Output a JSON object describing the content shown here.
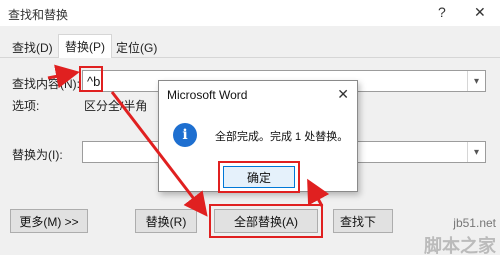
{
  "window": {
    "title": "查找和替换",
    "help_glyph": "?",
    "close_glyph": "✕"
  },
  "tabs": [
    {
      "label": "查找(D)",
      "active": false
    },
    {
      "label": "替换(P)",
      "active": true
    },
    {
      "label": "定位(G)",
      "active": false
    }
  ],
  "find": {
    "label": "查找内容(N):",
    "value": "^b"
  },
  "options": {
    "label": "选项:",
    "value": "区分全/半角"
  },
  "replace": {
    "label": "替换为(I):",
    "value": ""
  },
  "buttons": {
    "more": "更多(M) >>",
    "replace": "替换(R)",
    "replace_all": "全部替换(A)",
    "find_next": "查找下"
  },
  "message_box": {
    "title": "Microsoft Word",
    "text": "全部完成。完成 1 处替换。",
    "ok": "确定",
    "close_glyph": "✕",
    "icon_glyph": "i"
  },
  "watermark": {
    "site": "jb51.net",
    "brand": "脚本之家"
  },
  "colors": {
    "highlight": "#e02020",
    "info_icon": "#1e6fd0"
  }
}
